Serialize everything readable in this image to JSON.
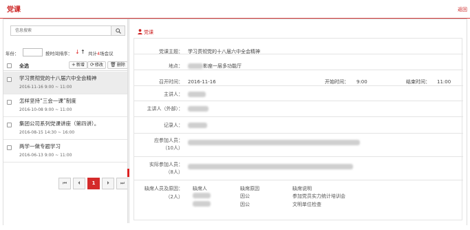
{
  "header": {
    "title": "党课",
    "back": "返回"
  },
  "search": {
    "placeholder": "信息搜索"
  },
  "filter": {
    "year_label": "年份：",
    "sort_label": "按时间排序：",
    "count_prefix": "共计",
    "count": "4",
    "count_suffix": "场会议"
  },
  "toolbar": {
    "select_all": "全选",
    "add": "新增",
    "edit": "修改",
    "delete": "删除"
  },
  "lessons": [
    {
      "title": "学习贯彻党的十八届六中全会精神",
      "time": "2016-11-16  9:00 ~ 11:00",
      "selected": true
    },
    {
      "title": "怎样坚持“三会一课”制度",
      "time": "2016-10-08  9:00 ~ 11:00",
      "selected": false
    },
    {
      "title": "集团公司系列党课讲座（第四讲）。",
      "time": "2016-08-15  14:30 ~ 16:00",
      "selected": false
    },
    {
      "title": "两学一做专题学习",
      "time": "2016-06-13  9:00 ~ 11:00",
      "selected": false
    }
  ],
  "pager": {
    "first": "⏮",
    "prev": "⏴",
    "current": "1",
    "next": "⏵",
    "last": "⏭"
  },
  "detail": {
    "section_label": "党课",
    "subject_label": "党课主题：",
    "subject": "学习贯彻党的十八届六中全会精神",
    "location_label": "地点：",
    "location_suffix": "影座一层多功能厅",
    "date_label": "召开时间：",
    "date": "2016-11-16",
    "start_label": "开始时间：",
    "start": "9:00",
    "end_label": "结束时间：",
    "end": "11:00",
    "speaker_label": "主讲人：",
    "ext_speaker_label": "主讲人（外部）：",
    "recorder_label": "记录人：",
    "expected_label": "应参加人员：",
    "expected_count": "（10人）",
    "actual_label": "实际参加人员：",
    "actual_count": "（8人）",
    "absent_label": "缺席人员及原因：",
    "absent_count": "（2人）",
    "absent_headers": [
      "缺席人",
      "缺席原因",
      "缺席说明"
    ],
    "absent_rows": [
      {
        "reason": "因公",
        "note": "参加党员实力统计培训会"
      },
      {
        "reason": "因公",
        "note": "文明单位检查"
      }
    ]
  },
  "colors": {
    "accent": "#cc2222",
    "selected_row": "#ececec"
  }
}
